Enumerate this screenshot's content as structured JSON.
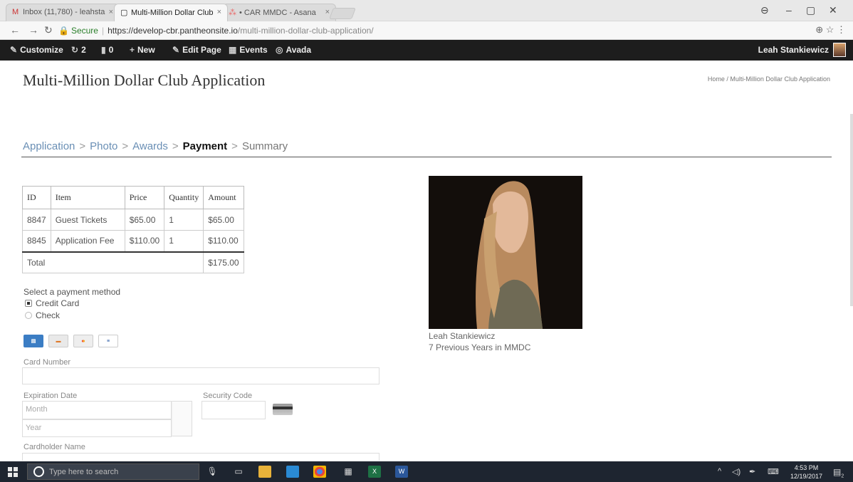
{
  "browser": {
    "tabs": [
      {
        "label": "Inbox (11,780) - leahsta",
        "icon": "M"
      },
      {
        "label": "Multi-Million Dollar Club",
        "icon": "▢"
      },
      {
        "label": "• CAR MMDC - Asana",
        "icon": "⁂"
      }
    ],
    "url": {
      "secure": "Secure",
      "host": "https://develop-cbr.pantheonsite.io",
      "path": "/multi-million-dollar-club-application/"
    }
  },
  "admin_bar": {
    "customize": "Customize",
    "updates": "2",
    "comments": "0",
    "new": "New",
    "edit_page": "Edit Page",
    "events": "Events",
    "avada": "Avada",
    "user": "Leah Stankiewicz"
  },
  "page": {
    "title": "Multi-Million Dollar Club Application",
    "breadcrumb": "Home / Multi-Million Dollar Club Application",
    "steps": [
      "Application",
      "Photo",
      "Awards",
      "Payment",
      "Summary"
    ]
  },
  "cart": {
    "headers": [
      "ID",
      "Item",
      "Price",
      "Quantity",
      "Amount"
    ],
    "rows": [
      {
        "id": "8847",
        "item": "Guest Tickets",
        "price": "$65.00",
        "qty": "1",
        "amount": "$65.00"
      },
      {
        "id": "8845",
        "item": "Application Fee",
        "price": "$110.00",
        "qty": "1",
        "amount": "$110.00"
      }
    ],
    "total_label": "Total",
    "total_amount": "$175.00"
  },
  "payment": {
    "label": "Select a payment method",
    "methods": [
      {
        "label": "Credit Card",
        "selected": true
      },
      {
        "label": "Check",
        "selected": false
      }
    ],
    "cards": [
      "amex-icon",
      "discover-icon",
      "mastercard-icon",
      "visa-icon"
    ],
    "card_number_label": "Card Number",
    "expiration_label": "Expiration Date",
    "month_placeholder": "Month",
    "year_placeholder": "Year",
    "security_label": "Security Code",
    "cardholder_label": "Cardholder Name"
  },
  "profile": {
    "name": "Leah Stankiewicz",
    "years": "7 Previous Years in MMDC"
  },
  "taskbar": {
    "search": "Type here to search",
    "time": "4:53 PM",
    "date": "12/19/2017",
    "notifications": "2"
  }
}
